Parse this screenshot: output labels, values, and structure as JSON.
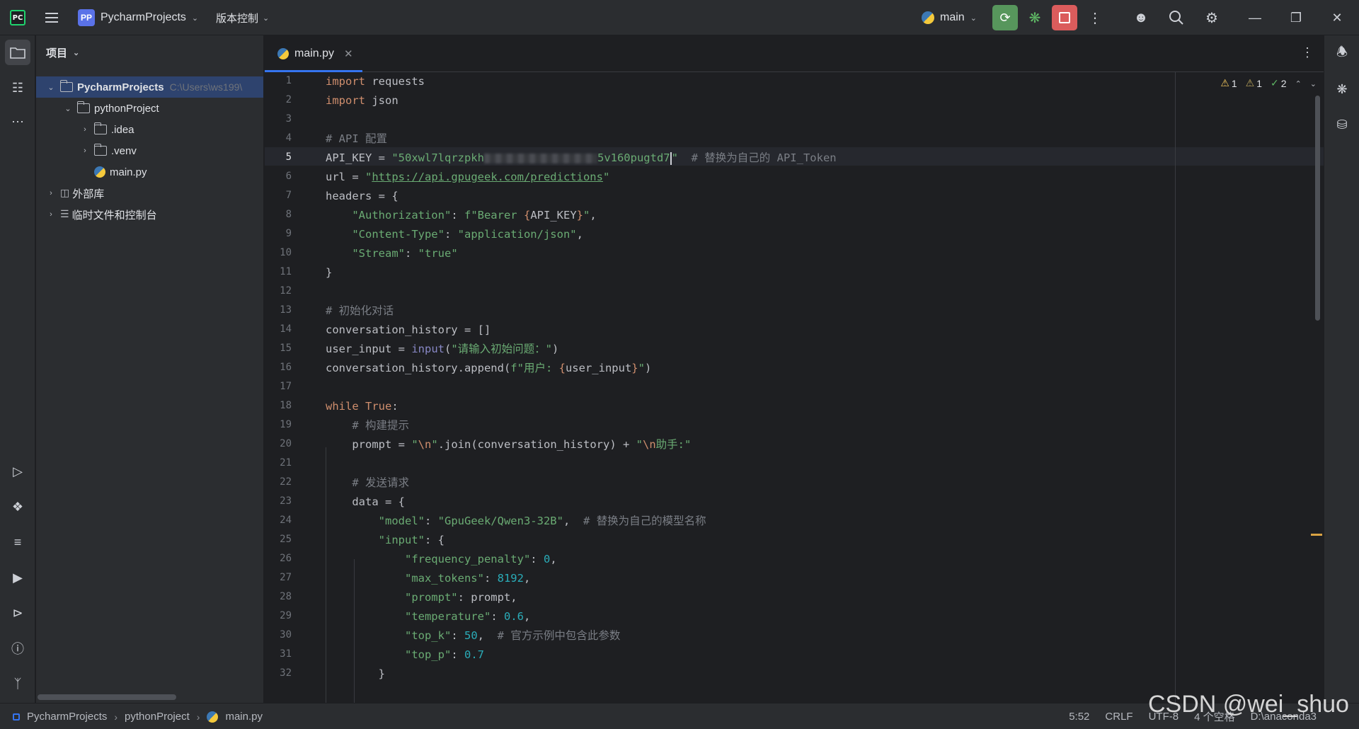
{
  "titlebar": {
    "logo": "PC",
    "project_badge": "PP",
    "project_name": "PycharmProjects",
    "vcs_label": "版本控制",
    "run_config": "main"
  },
  "project_panel": {
    "header": "项目",
    "tree": [
      {
        "label": "PycharmProjects",
        "path": "C:\\Users\\ws199\\"
      },
      {
        "label": "pythonProject"
      },
      {
        "label": ".idea"
      },
      {
        "label": ".venv"
      },
      {
        "label": "main.py"
      },
      {
        "label": "外部库"
      },
      {
        "label": "临时文件和控制台"
      }
    ]
  },
  "editor": {
    "tab_label": "main.py",
    "inspections": {
      "warnings": "1",
      "weak_warnings": "1",
      "ok": "2"
    },
    "line_numbers": [
      "1",
      "2",
      "3",
      "4",
      "5",
      "6",
      "7",
      "8",
      "9",
      "10",
      "11",
      "12",
      "13",
      "14",
      "15",
      "16",
      "17",
      "18",
      "19",
      "20",
      "21",
      "22",
      "23",
      "24",
      "25",
      "26",
      "27",
      "28",
      "29",
      "30",
      "31",
      "32"
    ],
    "current_line": 5,
    "code": {
      "l1a": "import",
      "l1b": " requests",
      "l2a": "import",
      "l2b": " json",
      "l4": "# API 配置",
      "l5a": "API_KEY = ",
      "l5b": "\"50xwl7lqrzpkh",
      "l5c": "5v160pugtd7",
      "l5d": "\"",
      "l5e": "  # 替换为自己的 API_Token",
      "l6a": "url = ",
      "l6b": "\"",
      "l6c": "https://api.gpugeek.com/predictions",
      "l6d": "\"",
      "l7": "headers = {",
      "l8a": "    ",
      "l8b": "\"Authorization\"",
      "l8c": ": ",
      "l8d": "f\"Bearer ",
      "l8e": "{",
      "l8f": "API_KEY",
      "l8g": "}",
      "l8h": "\"",
      "l8i": ",",
      "l9a": "    ",
      "l9b": "\"Content-Type\"",
      "l9c": ": ",
      "l9d": "\"application/json\"",
      "l9e": ",",
      "l10a": "    ",
      "l10b": "\"Stream\"",
      "l10c": ": ",
      "l10d": "\"true\"",
      "l11": "}",
      "l13": "# 初始化对话",
      "l14": "conversation_history = []",
      "l15a": "user_input = ",
      "l15b": "input",
      "l15c": "(",
      "l15d": "\"请输入初始问题：\"",
      "l15e": ")",
      "l16a": "conversation_history.append(",
      "l16b": "f\"用户: ",
      "l16c": "{",
      "l16d": "user_input",
      "l16e": "}",
      "l16f": "\"",
      "l16g": ")",
      "l18a": "while",
      "l18b": " ",
      "l18c": "True",
      "l18d": ":",
      "l19": "    # 构建提示",
      "l20a": "    prompt = ",
      "l20b": "\"",
      "l20c": "\\n",
      "l20d": "\"",
      "l20e": ".join(conversation_history) + ",
      "l20f": "\"",
      "l20g": "\\n",
      "l20h": "助手:\"",
      "l22": "    # 发送请求",
      "l23": "    data = {",
      "l24a": "        ",
      "l24b": "\"model\"",
      "l24c": ": ",
      "l24d": "\"GpuGeek/Qwen3-32B\"",
      "l24e": ",  ",
      "l24f": "# 替换为自己的模型名称",
      "l25a": "        ",
      "l25b": "\"input\"",
      "l25c": ": {",
      "l26a": "            ",
      "l26b": "\"frequency_penalty\"",
      "l26c": ": ",
      "l26d": "0",
      "l26e": ",",
      "l27a": "            ",
      "l27b": "\"max_tokens\"",
      "l27c": ": ",
      "l27d": "8192",
      "l27e": ",",
      "l28a": "            ",
      "l28b": "\"prompt\"",
      "l28c": ": prompt,",
      "l29a": "            ",
      "l29b": "\"temperature\"",
      "l29c": ": ",
      "l29d": "0.6",
      "l29e": ",",
      "l30a": "            ",
      "l30b": "\"top_k\"",
      "l30c": ": ",
      "l30d": "50",
      "l30e": ",  ",
      "l30f": "# 官方示例中包含此参数",
      "l31a": "            ",
      "l31b": "\"top_p\"",
      "l31c": ": ",
      "l31d": "0.7",
      "l32": "        }"
    }
  },
  "statusbar": {
    "crumbs": [
      "PycharmProjects",
      "pythonProject",
      "main.py"
    ],
    "position": "5:52",
    "line_sep": "CRLF",
    "encoding": "UTF-8",
    "indent": "4 个空格",
    "interpreter": "D:\\anaconda3"
  },
  "watermark": "CSDN @wei_shuo",
  "colors": {
    "accent": "#3574f0",
    "run": "#57965c",
    "stop": "#db5c5c",
    "keyword": "#cf8e6d",
    "string": "#6aab73",
    "comment": "#7a7e85",
    "number": "#2aacb8"
  },
  "icons": [
    "hamburger-icon",
    "run-icon",
    "debug-icon",
    "stop-icon",
    "more-icon",
    "add-user-icon",
    "search-icon",
    "settings-icon",
    "minimize-icon",
    "restore-icon",
    "close-icon",
    "folder-icon",
    "structure-icon",
    "run-tool-icon",
    "python-console-icon",
    "layers-icon",
    "services-icon",
    "terminal-icon",
    "problems-icon",
    "git-icon",
    "bell-icon",
    "ai-assistant-icon",
    "database-icon"
  ]
}
